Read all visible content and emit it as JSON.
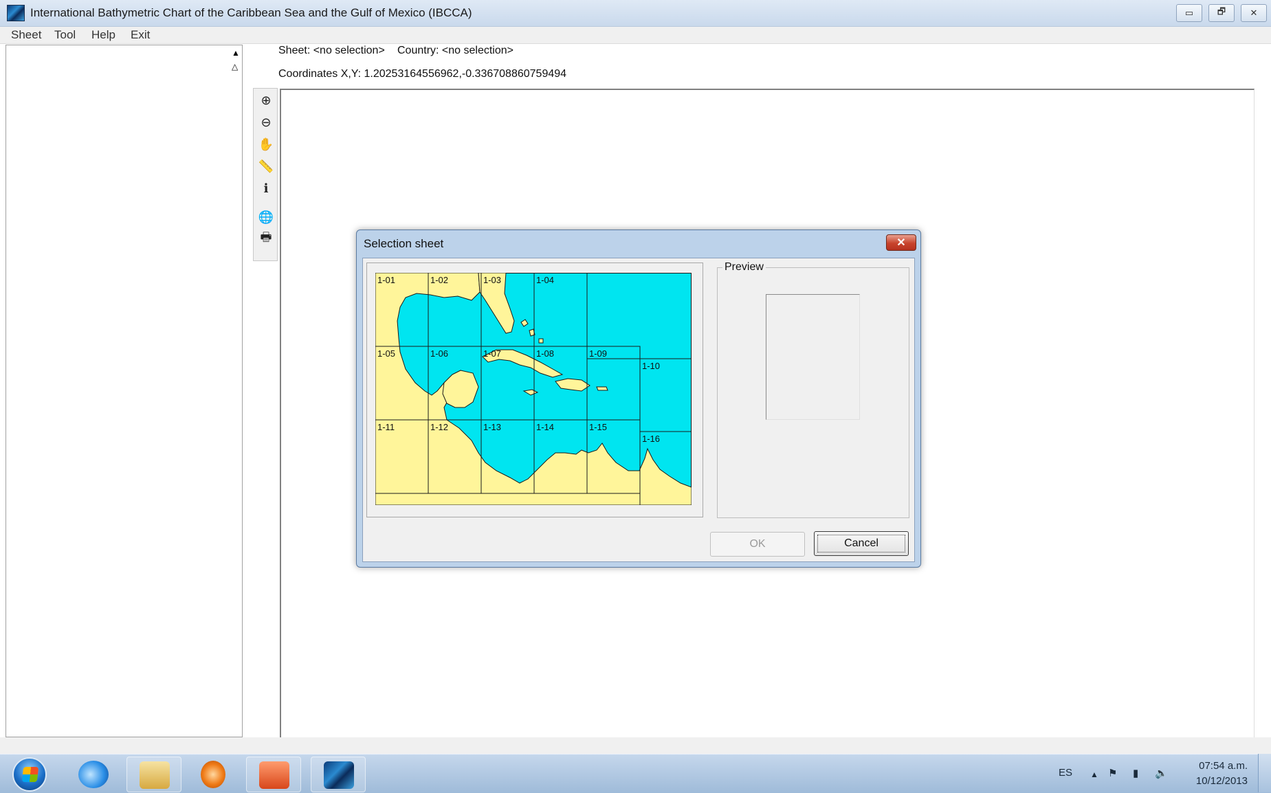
{
  "window": {
    "title": "International Bathymetric Chart of the Caribbean Sea and the Gulf of Mexico (IBCCA)",
    "minimize_glyph": "▭",
    "restore_glyph": "🗗",
    "close_glyph": "✕"
  },
  "menu": [
    "Sheet",
    "Tool",
    "Help",
    "Exit"
  ],
  "info": {
    "sheet_label": "Sheet: <no selection>",
    "country_label": "Country: <no selection>",
    "coordinates_label": "Coordinates X,Y: 1.20253164556962,-0.336708860759494"
  },
  "toolbar": [
    {
      "icon": "zoom-in-icon",
      "glyph": "⊕"
    },
    {
      "icon": "zoom-out-icon",
      "glyph": "⊖"
    },
    {
      "icon": "pan-hand-icon",
      "glyph": "✋"
    },
    {
      "icon": "ruler-icon",
      "glyph": "📏"
    },
    {
      "icon": "info-icon",
      "glyph": "ℹ"
    },
    {
      "icon": "globe-icon",
      "glyph": "🌐"
    },
    {
      "icon": "printer-icon",
      "glyph": "🖶"
    }
  ],
  "dialog": {
    "title": "Selection sheet",
    "close_glyph": "✕",
    "preview_label": "Preview",
    "ok_label": "OK",
    "cancel_label": "Cancel",
    "sheets": [
      "1-01",
      "1-02",
      "1-03",
      "1-04",
      "1-05",
      "1-06",
      "1-07",
      "1-08",
      "1-09",
      "1-10",
      "1-11",
      "1-12",
      "1-13",
      "1-14",
      "1-15",
      "1-16"
    ],
    "colors": {
      "sea": "#00e5f0",
      "land": "#fff59a",
      "grid": "#1a1a1a"
    }
  },
  "tray": {
    "language": "ES",
    "time": "07:54 a.m.",
    "date": "10/12/2013"
  }
}
